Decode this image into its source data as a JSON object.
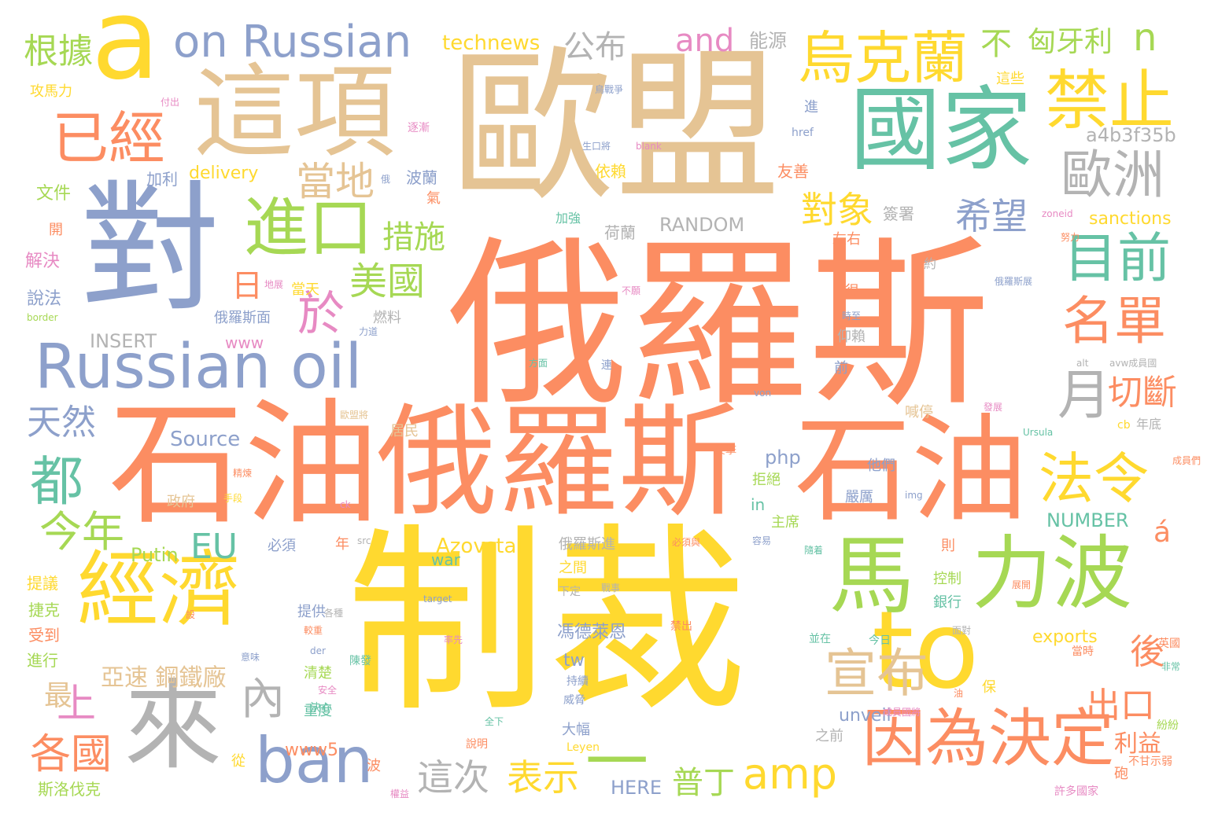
{
  "word_cloud": {
    "palette": {
      "tan": "#E5C494",
      "orange": "#FC8D62",
      "yellow": "#FFD92F",
      "blue": "#8DA0CB",
      "green": "#66C2A5",
      "lime": "#A6D854",
      "gray": "#B3B3B3",
      "pink": "#E78AC3"
    },
    "words": [
      {
        "text": "俄羅斯",
        "color": "orange"
      },
      {
        "text": "歐盟",
        "color": "tan"
      },
      {
        "text": "制裁",
        "color": "yellow"
      },
      {
        "text": "石油",
        "color": "orange"
      },
      {
        "text": "俄羅斯",
        "color": "orange"
      },
      {
        "text": "石油",
        "color": "orange"
      },
      {
        "text": "對",
        "color": "blue"
      },
      {
        "text": "這項",
        "color": "tan"
      },
      {
        "text": "國家",
        "color": "green"
      },
      {
        "text": "a",
        "color": "yellow"
      },
      {
        "text": "Russian oil",
        "color": "blue"
      },
      {
        "text": "on Russian",
        "color": "blue"
      },
      {
        "text": "經濟",
        "color": "yellow"
      },
      {
        "text": "來",
        "color": "gray"
      },
      {
        "text": "to",
        "color": "yellow"
      },
      {
        "text": "力波",
        "color": "lime"
      },
      {
        "text": "馬",
        "color": "lime"
      },
      {
        "text": "烏克蘭",
        "color": "yellow"
      },
      {
        "text": "禁止",
        "color": "yellow"
      },
      {
        "text": "進口",
        "color": "lime"
      },
      {
        "text": "因為決定",
        "color": "orange"
      },
      {
        "text": "ban",
        "color": "blue"
      },
      {
        "text": "已經",
        "color": "orange"
      },
      {
        "text": "歐洲",
        "color": "gray"
      },
      {
        "text": "宣布",
        "color": "tan"
      },
      {
        "text": "目前",
        "color": "green"
      },
      {
        "text": "名單",
        "color": "orange"
      },
      {
        "text": "法令",
        "color": "yellow"
      },
      {
        "text": "都",
        "color": "green"
      },
      {
        "text": "一",
        "color": "lime"
      },
      {
        "text": "amp",
        "color": "yellow"
      },
      {
        "text": "各國",
        "color": "orange"
      },
      {
        "text": "今年",
        "color": "lime"
      },
      {
        "text": "內",
        "color": "gray"
      },
      {
        "text": "上",
        "color": "pink"
      },
      {
        "text": "月",
        "color": "gray"
      },
      {
        "text": "於",
        "color": "pink"
      },
      {
        "text": "美國",
        "color": "lime"
      },
      {
        "text": "措施",
        "color": "lime"
      },
      {
        "text": "希望",
        "color": "blue"
      },
      {
        "text": "對象",
        "color": "yellow"
      },
      {
        "text": "當地",
        "color": "tan"
      },
      {
        "text": "切斷",
        "color": "orange"
      },
      {
        "text": "出口",
        "color": "orange"
      },
      {
        "text": "天然",
        "color": "blue"
      },
      {
        "text": "表示",
        "color": "yellow"
      },
      {
        "text": "這次",
        "color": "gray"
      },
      {
        "text": "普丁",
        "color": "lime"
      },
      {
        "text": "後",
        "color": "orange"
      },
      {
        "text": "EU",
        "color": "green"
      },
      {
        "text": "根據",
        "color": "lime"
      },
      {
        "text": "and",
        "color": "pink"
      },
      {
        "text": "n",
        "color": "lime"
      },
      {
        "text": "公布",
        "color": "gray"
      },
      {
        "text": "technews",
        "color": "yellow"
      },
      {
        "text": "不",
        "color": "lime"
      },
      {
        "text": "匈牙利",
        "color": "lime"
      },
      {
        "text": "最",
        "color": "tan"
      },
      {
        "text": "日",
        "color": "orange"
      },
      {
        "text": "亞速 鋼鐵廠",
        "color": "tan"
      },
      {
        "text": "能源",
        "color": "gray"
      },
      {
        "text": "a4b3f35b",
        "color": "gray"
      },
      {
        "text": "á",
        "color": "orange"
      },
      {
        "text": "利益",
        "color": "orange"
      },
      {
        "text": "Source",
        "color": "blue"
      },
      {
        "text": "Azovstal",
        "color": "yellow"
      },
      {
        "text": "Putin",
        "color": "lime"
      },
      {
        "text": "RANDOM",
        "color": "gray"
      },
      {
        "text": "INSERT",
        "color": "gray"
      },
      {
        "text": "NUMBER",
        "color": "green"
      },
      {
        "text": "sanctions",
        "color": "yellow"
      },
      {
        "text": "delivery",
        "color": "yellow"
      },
      {
        "text": "exports",
        "color": "yellow"
      },
      {
        "text": "unveil",
        "color": "blue"
      },
      {
        "text": "HERE",
        "color": "blue"
      },
      {
        "text": "www",
        "color": "pink"
      },
      {
        "text": "www5",
        "color": "orange"
      },
      {
        "text": "php",
        "color": "blue"
      },
      {
        "text": "tw",
        "color": "blue"
      },
      {
        "text": "war",
        "color": "green"
      },
      {
        "text": "in",
        "color": "green"
      },
      {
        "text": "依賴",
        "color": "yellow"
      },
      {
        "text": "友善",
        "color": "orange"
      },
      {
        "text": "簽署",
        "color": "gray"
      },
      {
        "text": "波蘭",
        "color": "blue"
      },
      {
        "text": "荷蘭",
        "color": "gray"
      },
      {
        "text": "加利",
        "color": "blue"
      },
      {
        "text": "文件",
        "color": "lime"
      },
      {
        "text": "解決",
        "color": "pink"
      },
      {
        "text": "說法",
        "color": "blue"
      },
      {
        "text": "開",
        "color": "orange"
      },
      {
        "text": "攻馬力",
        "color": "yellow"
      },
      {
        "text": "這些",
        "color": "yellow"
      },
      {
        "text": "進",
        "color": "blue"
      },
      {
        "text": "加強",
        "color": "green"
      },
      {
        "text": "當天",
        "color": "yellow"
      },
      {
        "text": "俄羅斯面",
        "color": "blue"
      },
      {
        "text": "燃料",
        "color": "gray"
      },
      {
        "text": "仰賴",
        "color": "gray"
      },
      {
        "text": "很",
        "color": "orange"
      },
      {
        "text": "左右",
        "color": "orange"
      },
      {
        "text": "約",
        "color": "gray"
      },
      {
        "text": "喊停",
        "color": "tan"
      },
      {
        "text": "他們",
        "color": "blue"
      },
      {
        "text": "居民",
        "color": "tan"
      },
      {
        "text": "拒絕",
        "color": "lime"
      },
      {
        "text": "嚴厲",
        "color": "blue"
      },
      {
        "text": "主席",
        "color": "lime"
      },
      {
        "text": "政府",
        "color": "tan"
      },
      {
        "text": "必須",
        "color": "blue"
      },
      {
        "text": "年",
        "color": "orange"
      },
      {
        "text": "俄羅斯進",
        "color": "gray"
      },
      {
        "text": "之間",
        "color": "yellow"
      },
      {
        "text": "控制",
        "color": "lime"
      },
      {
        "text": "銀行",
        "color": "green"
      },
      {
        "text": "提供",
        "color": "blue"
      },
      {
        "text": "馮德萊恩",
        "color": "blue"
      },
      {
        "text": "清楚",
        "color": "lime"
      },
      {
        "text": "重度",
        "color": "green"
      },
      {
        "text": "大幅",
        "color": "blue"
      },
      {
        "text": "前",
        "color": "blue"
      },
      {
        "text": "之前",
        "color": "gray"
      },
      {
        "text": "波",
        "color": "orange"
      },
      {
        "text": "從",
        "color": "yellow"
      },
      {
        "text": "則",
        "color": "orange"
      },
      {
        "text": "保",
        "color": "yellow"
      },
      {
        "text": "砲",
        "color": "orange"
      },
      {
        "text": "提議",
        "color": "yellow"
      },
      {
        "text": "捷克",
        "color": "lime"
      },
      {
        "text": "受到",
        "color": "orange"
      },
      {
        "text": "進行",
        "color": "lime"
      },
      {
        "text": "斯洛伐克",
        "color": "lime"
      },
      {
        "text": "年底",
        "color": "gray"
      },
      {
        "text": "cb",
        "color": "yellow"
      },
      {
        "text": "下定",
        "color": "gray"
      },
      {
        "text": "烏戰爭",
        "color": "blue"
      },
      {
        "text": "付出",
        "color": "pink"
      },
      {
        "text": "逐漸",
        "color": "pink"
      },
      {
        "text": "生口將",
        "color": "blue"
      },
      {
        "text": "blank",
        "color": "pink"
      },
      {
        "text": "href",
        "color": "blue"
      },
      {
        "text": "俄",
        "color": "blue"
      },
      {
        "text": "氣",
        "color": "orange"
      },
      {
        "text": "zoneid",
        "color": "pink"
      },
      {
        "text": "努力",
        "color": "orange"
      },
      {
        "text": "地展",
        "color": "pink"
      },
      {
        "text": "不願",
        "color": "pink"
      },
      {
        "text": "俄羅斯展",
        "color": "blue"
      },
      {
        "text": "border",
        "color": "lime"
      },
      {
        "text": "力道",
        "color": "blue"
      },
      {
        "text": "時至",
        "color": "blue"
      },
      {
        "text": "方面",
        "color": "green"
      },
      {
        "text": "連",
        "color": "blue"
      },
      {
        "text": "alt",
        "color": "gray"
      },
      {
        "text": "avw成員國",
        "color": "gray"
      },
      {
        "text": "歐盟將",
        "color": "tan"
      },
      {
        "text": "von",
        "color": "blue"
      },
      {
        "text": "發展",
        "color": "pink"
      },
      {
        "text": "Ursula",
        "color": "green"
      },
      {
        "text": "反擊",
        "color": "orange"
      },
      {
        "text": "精煉",
        "color": "orange"
      },
      {
        "text": "手段",
        "color": "yellow"
      },
      {
        "text": "ck",
        "color": "pink"
      },
      {
        "text": "img",
        "color": "blue"
      },
      {
        "text": "src",
        "color": "gray"
      },
      {
        "text": "必須與",
        "color": "orange"
      },
      {
        "text": "容易",
        "color": "blue"
      },
      {
        "text": "隨着",
        "color": "green"
      },
      {
        "text": "展開",
        "color": "orange"
      },
      {
        "text": "戰事",
        "color": "gray"
      },
      {
        "text": "target",
        "color": "blue"
      },
      {
        "text": "禁出",
        "color": "orange"
      },
      {
        "text": "各種",
        "color": "gray"
      },
      {
        "text": "較重",
        "color": "orange"
      },
      {
        "text": "der",
        "color": "blue"
      },
      {
        "text": "面對",
        "color": "gray"
      },
      {
        "text": "並在",
        "color": "green"
      },
      {
        "text": "今日",
        "color": "green"
      },
      {
        "text": "率先",
        "color": "pink"
      },
      {
        "text": "英國",
        "color": "orange"
      },
      {
        "text": "當時",
        "color": "orange"
      },
      {
        "text": "非常",
        "color": "green"
      },
      {
        "text": "意味",
        "color": "blue"
      },
      {
        "text": "陳發",
        "color": "green"
      },
      {
        "text": "持續",
        "color": "blue"
      },
      {
        "text": "威脅",
        "color": "blue"
      },
      {
        "text": "決心",
        "color": "green"
      },
      {
        "text": "全下",
        "color": "green"
      },
      {
        "text": "Leyen",
        "color": "yellow"
      },
      {
        "text": "說明",
        "color": "orange"
      },
      {
        "text": "成員國將",
        "color": "pink"
      },
      {
        "text": "紛紛",
        "color": "lime"
      },
      {
        "text": "不甘示弱",
        "color": "orange"
      },
      {
        "text": "許多國家",
        "color": "pink"
      },
      {
        "text": "權益",
        "color": "pink"
      },
      {
        "text": "安全",
        "color": "pink"
      },
      {
        "text": "油",
        "color": "orange"
      },
      {
        "text": "成員們",
        "color": "orange"
      },
      {
        "text": "設",
        "color": "orange"
      }
    ]
  }
}
